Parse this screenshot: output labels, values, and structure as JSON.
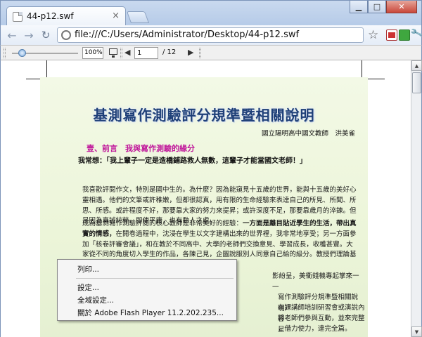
{
  "browser": {
    "tab_title": "44-p12.swf",
    "tab_close_glyph": "×",
    "url": "file:///C:/Users/Administrator/Desktop/44-p12.swf",
    "window_buttons": {
      "minimize": "▁",
      "maximize": "□",
      "close": "✕"
    }
  },
  "toolbar": {
    "zoom_value": "100%",
    "zoom_level": 1.0,
    "current_page": "1",
    "total_pages": "/  12"
  },
  "document": {
    "title": "基測寫作測驗評分規準暨相關說明",
    "author": "國立陽明高中國文教師　洪美雀",
    "section_heading": "壹、前言　我與寫作測驗的緣分",
    "quote": "我常想：「我上輩子一定是造橋鋪路救人無數，這輩子才能當國文老師！」",
    "para1": "我喜歡評閱作文，特別是國中生的。為什麼？因為能窺見十五歲的世界，能與十五歲的美好心靈相遇。他們的文筆或許稚嫩，但都很認真，用有限的生命經驗來表達自己的所見、所聞、所思、所感。或許程度不好，那要靠大家的努力來提昇；或許深度不足，那要靠歲月的淬鍊。但是因為真誠純粹，即使平庸，也有動人之處。",
    "para2_lead": "成為基測寫作測驗評閱的核心教師是非常美好的經驗：",
    "para2_bold": "一方面是離目貼近學生的生活，帶出真實的情感，",
    "para2_rest": "在閱卷過程中，沈浸在學生以文字建構出來的世界裡，我非常地享受；另一方面參加「核卷評審會議」，和在教於不同高中、大學的老師們交換意見、學習成長，收穫甚豐。大家從不同的角度切入學生的作品，各陳己見，企圖說服別人同意自己給的級分。教授們理論基礎深，我們實務經驗豐，每每力光劍影互不",
    "para2_tail": "影紛呈，美衝錢機專起掌來一一",
    "right1": "寫作測驗評分規準暨相關說明〉",
    "right2": "在課講師培訓研習會或演說內容",
    "right3": "將老師們參與互動，並來完整呈",
    "right4": "，借力使力，達完全篇。",
    "para3": "一直以為自己對評閱作文的熱愛是「只是自個情」，特別是高中聯考取消作文之後，我成了先去閱讀的渴望，只能隨著遊月乎去，逐根以還有機會再回顧涯，而且不"
  },
  "context_menu": {
    "items": [
      "列印...",
      "設定...",
      "全域設定...",
      "關於 Adobe Flash Player 11.2.202.235..."
    ]
  }
}
